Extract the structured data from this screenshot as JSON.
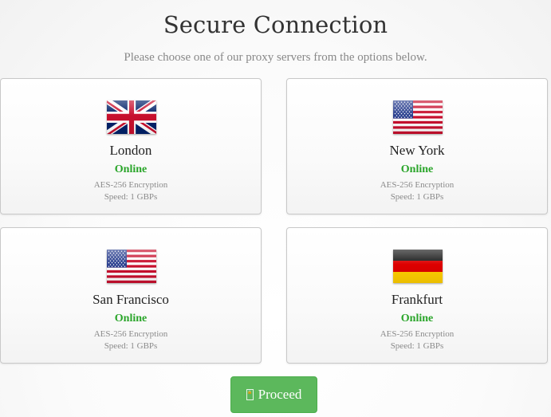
{
  "header": {
    "title": "Secure Connection",
    "subtitle": "Please choose one of our proxy servers from the options below."
  },
  "servers": [
    {
      "city": "London",
      "status": "Online",
      "encryption": "AES-256 Encryption",
      "speed": "Speed: 1 GBPs",
      "flag": "uk-flag-icon"
    },
    {
      "city": "New York",
      "status": "Online",
      "encryption": "AES-256 Encryption",
      "speed": "Speed: 1 GBPs",
      "flag": "us-flag-icon"
    },
    {
      "city": "San Francisco",
      "status": "Online",
      "encryption": "AES-256 Encryption",
      "speed": "Speed: 1 GBPs",
      "flag": "us-flag-icon"
    },
    {
      "city": "Frankfurt",
      "status": "Online",
      "encryption": "AES-256 Encryption",
      "speed": "Speed: 1 GBPs",
      "flag": "germany-flag-icon"
    }
  ],
  "proceed": {
    "label": "Proceed",
    "icon": "proceed-icon",
    "icon_glyph": "🔒"
  },
  "colors": {
    "status_online": "#2aa52a",
    "button": "#5cb85c",
    "title": "#333333",
    "subtitle": "#888888"
  }
}
